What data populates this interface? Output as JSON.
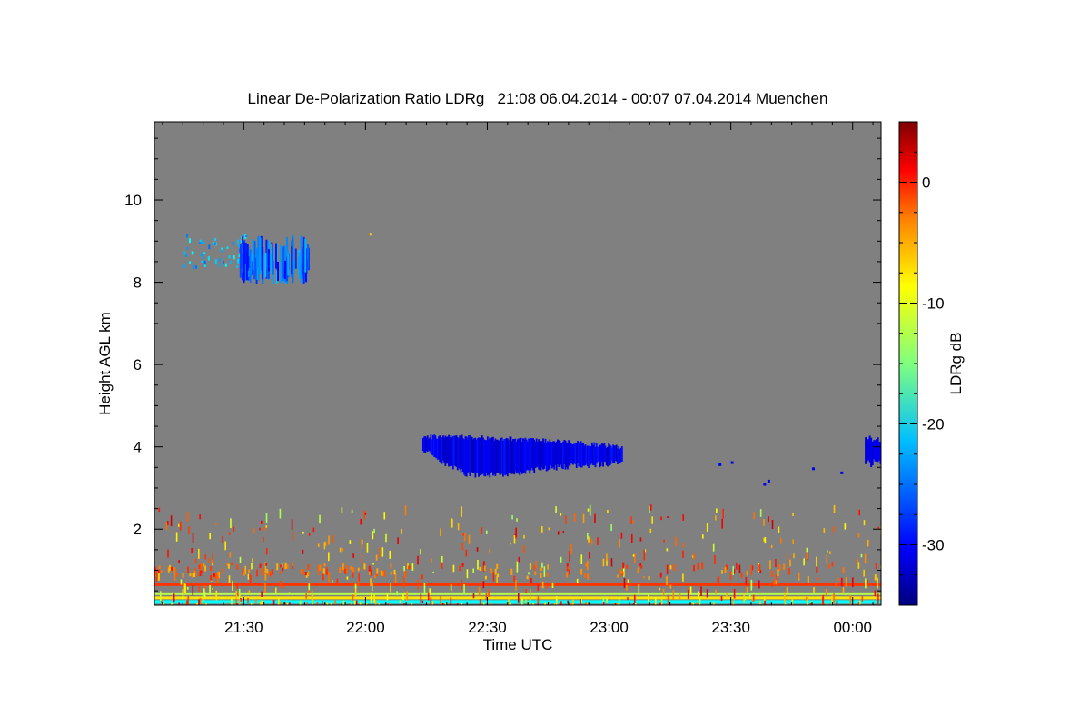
{
  "chart_data": {
    "type": "heatmap",
    "title": "Linear De-Polarization Ratio LDRg   21:08 06.04.2014 - 00:07 07.04.2014 Muenchen",
    "xlabel": "Time UTC",
    "ylabel": "Height AGL km",
    "colorbar_label": "LDRg dB",
    "x_range_min": [
      1268,
      1447
    ],
    "y_range_km": [
      0.15,
      11.9
    ],
    "x_ticks": [
      {
        "min": 1290,
        "label": "21:30"
      },
      {
        "min": 1320,
        "label": "22:00"
      },
      {
        "min": 1350,
        "label": "22:30"
      },
      {
        "min": 1380,
        "label": "23:00"
      },
      {
        "min": 1410,
        "label": "23:30"
      },
      {
        "min": 1440,
        "label": "00:00"
      }
    ],
    "y_ticks": [
      {
        "km": 2,
        "label": "2"
      },
      {
        "km": 4,
        "label": "4"
      },
      {
        "km": 6,
        "label": "6"
      },
      {
        "km": 8,
        "label": "8"
      },
      {
        "km": 10,
        "label": "10"
      }
    ],
    "colorbar_range_db": [
      -35,
      5
    ],
    "colorbar_ticks": [
      {
        "db": 0,
        "label": "0"
      },
      {
        "db": -10,
        "label": "-10"
      },
      {
        "db": -20,
        "label": "-20"
      },
      {
        "db": -30,
        "label": "-30"
      }
    ],
    "background_color": "#808080",
    "features": [
      {
        "kind": "cirrus_cloud",
        "t_start_min": 1275,
        "t_end_min": 1306,
        "h_bottom_km": 7.9,
        "h_top_km": 9.3,
        "ldr_db": -24
      },
      {
        "kind": "mid_level_cloud",
        "t_start_min": 1334,
        "t_end_min": 1383,
        "h_bottom_km": 3.25,
        "h_top_km": 4.35,
        "ldr_db": -31
      },
      {
        "kind": "mid_level_cloud_edge",
        "t_start_min": 1443,
        "t_end_min": 1447,
        "h_bottom_km": 3.5,
        "h_top_km": 4.3,
        "ldr_db": -31
      },
      {
        "kind": "boundary_layer_scatter",
        "t_start_min": 1268,
        "t_end_min": 1447,
        "h_bottom_km": 0.2,
        "h_top_km": 2.6,
        "ldr_db": -5
      }
    ]
  }
}
